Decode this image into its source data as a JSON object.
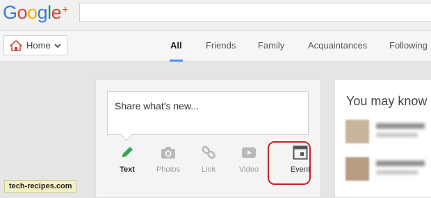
{
  "logo": {
    "text": "Google",
    "plus": "+"
  },
  "search": {
    "value": ""
  },
  "nav": {
    "home_label": "Home",
    "tabs": [
      "All",
      "Friends",
      "Family",
      "Acquaintances",
      "Following"
    ],
    "active_tab": "All"
  },
  "share": {
    "placeholder": "Share what's new...",
    "tools": [
      {
        "label": "Text",
        "icon": "pencil-icon"
      },
      {
        "label": "Photos",
        "icon": "camera-icon"
      },
      {
        "label": "Link",
        "icon": "link-icon"
      },
      {
        "label": "Video",
        "icon": "play-icon"
      },
      {
        "label": "Event",
        "icon": "calendar-icon"
      }
    ]
  },
  "suggestions": {
    "title": "You may know"
  },
  "watermark": "tech-recipes.com",
  "colors": {
    "accent": "#4c8fe8",
    "highlight": "#c42424",
    "pencil": "#36a852"
  }
}
